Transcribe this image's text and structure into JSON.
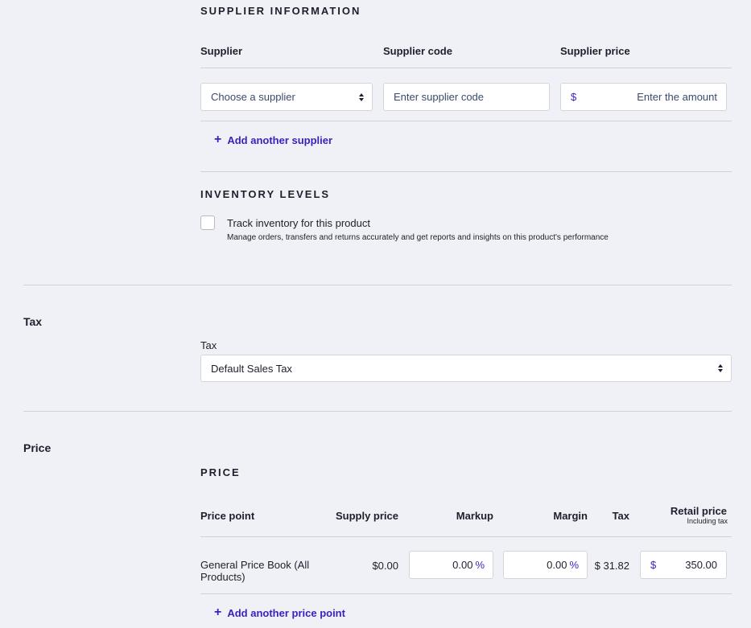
{
  "supplier_section": {
    "heading": "SUPPLIER INFORMATION",
    "columns": {
      "supplier": "Supplier",
      "code": "Supplier code",
      "price": "Supplier price"
    },
    "supplier_select": "Choose a supplier",
    "code_placeholder": "Enter supplier code",
    "price_currency": "$",
    "price_placeholder": "Enter the amount",
    "add_link": "Add another supplier"
  },
  "inventory": {
    "heading": "INVENTORY LEVELS",
    "checkbox_label": "Track inventory for this product",
    "checkbox_checked": false,
    "description": "Manage orders, transfers and returns accurately and get reports and insights on this product's performance"
  },
  "tax_section": {
    "label": "Tax",
    "field_label": "Tax",
    "selected": "Default Sales Tax"
  },
  "price_section": {
    "label": "Price",
    "heading": "PRICE",
    "columns": {
      "price_point": "Price point",
      "supply_price": "Supply price",
      "markup": "Markup",
      "margin": "Margin",
      "tax": "Tax",
      "retail_price": "Retail price",
      "retail_sub": "Including tax"
    },
    "rows": [
      {
        "name": "General Price Book (All Products)",
        "supply_price": "$0.00",
        "markup": "0.00",
        "markup_unit": "%",
        "margin": "0.00",
        "margin_unit": "%",
        "tax": "$ 31.82",
        "retail_currency": "$",
        "retail": "350.00"
      }
    ],
    "add_link": "Add another price point"
  },
  "colors": {
    "accent": "#3a1fbf",
    "background": "#f0f1f6",
    "divider": "#cfd0d8"
  },
  "icons": {
    "plus": "plus-icon",
    "stepper": "stepper-icon"
  }
}
